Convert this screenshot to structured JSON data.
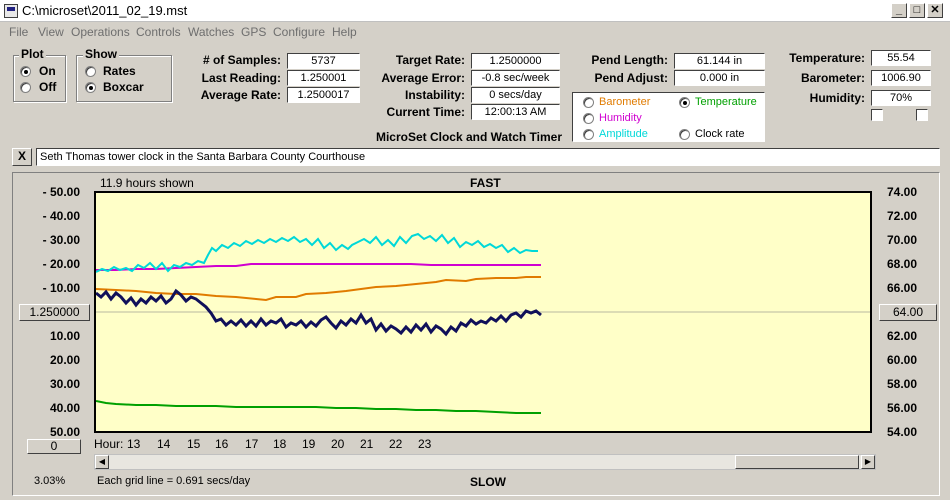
{
  "window": {
    "title": "C:\\microset\\2011_02_19.mst",
    "buttons": {
      "minimize": "_",
      "maximize": "□",
      "close": "✕"
    }
  },
  "menu": [
    "File",
    "View",
    "Operations",
    "Controls",
    "Watches",
    "GPS",
    "Configure",
    "Help"
  ],
  "plot_group": {
    "title": "Plot",
    "on_label": "On",
    "off_label": "Off",
    "selected": "On"
  },
  "show_group": {
    "title": "Show",
    "rates_label": "Rates",
    "boxcar_label": "Boxcar",
    "selected": "Boxcar"
  },
  "stats": {
    "samples_label": "# of Samples:",
    "samples_value": "5737",
    "last_reading_label": "Last Reading:",
    "last_reading_value": "1.250001",
    "average_rate_label": "Average Rate:",
    "average_rate_value": "1.2500017",
    "target_rate_label": "Target Rate:",
    "target_rate_value": "1.2500000",
    "average_error_label": "Average Error:",
    "average_error_value": "-0.8 sec/week",
    "instability_label": "Instability:",
    "instability_value": "0 secs/day",
    "current_time_label": "Current Time:",
    "current_time_value": "12:00:13 AM",
    "app_caption": "MicroSet Clock and Watch Timer"
  },
  "pendulum": {
    "length_label": "Pend Length:",
    "length_value": "61.144 in",
    "adjust_label": "Pend Adjust:",
    "adjust_value": "0.000 in"
  },
  "sensor_select": {
    "barometer": "Barometer",
    "temperature": "Temperature",
    "humidity": "Humidity",
    "amplitude": "Amplitude",
    "clock_rate": "Clock rate",
    "selected": "Temperature",
    "colors": {
      "barometer": "#e07b00",
      "temperature": "#00a000",
      "humidity": "#d000d0",
      "amplitude": "#00d8d8",
      "clock_rate": "#000000"
    }
  },
  "environment": {
    "temperature_label": "Temperature:",
    "temperature_value": "55.54",
    "barometer_label": "Barometer:",
    "barometer_value": "1006.90",
    "humidity_label": "Humidity:",
    "humidity_value": "70%"
  },
  "note": {
    "clear_button": "X",
    "text": "Seth Thomas tower clock in the Santa Barbara County Courthouse"
  },
  "graph": {
    "hours_shown": "11.9 hours shown",
    "top_label": "FAST",
    "bottom_label": "SLOW",
    "center_left_value": "1.250000",
    "center_right_value": "64.00",
    "zero_button": "0",
    "left_ticks": [
      "- 50.00",
      "- 40.00",
      "- 30.00",
      "- 20.00",
      "- 10.00",
      "10.00",
      "20.00",
      "30.00",
      "40.00",
      "50.00"
    ],
    "right_ticks": [
      "74.00",
      "72.00",
      "70.00",
      "68.00",
      "66.00",
      "62.00",
      "60.00",
      "58.00",
      "56.00",
      "54.00"
    ],
    "x_prefix": "Hour:",
    "x_ticks": [
      "13",
      "14",
      "15",
      "16",
      "17",
      "18",
      "19",
      "20",
      "21",
      "22",
      "23"
    ],
    "percent": "3.03%",
    "grid_note": "Each grid line = 0.691 secs/day",
    "plot_background": "#ffffc8"
  }
}
